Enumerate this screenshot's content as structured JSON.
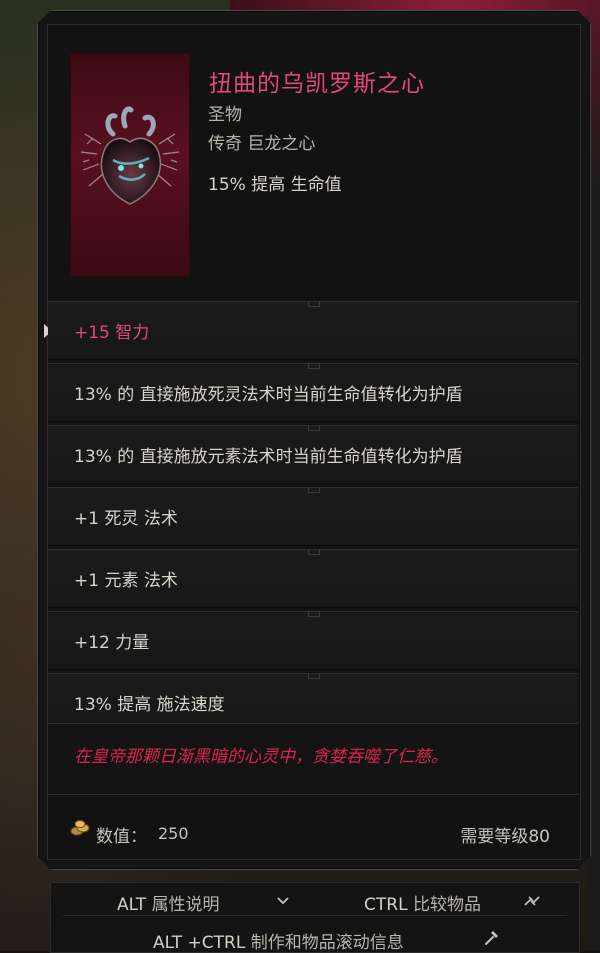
{
  "item": {
    "name": "扭曲的乌凯罗斯之心",
    "type": "圣物",
    "rarity": "传奇 巨龙之心",
    "implicit": "15% 提高 生命值",
    "art_icon": "twisted-heart-icon"
  },
  "mods": [
    {
      "text": "+15 智力",
      "highlight": true
    },
    {
      "text": "13% 的 直接施放死灵法术时当前生命值转化为护盾",
      "highlight": false
    },
    {
      "text": "13% 的 直接施放元素法术时当前生命值转化为护盾",
      "highlight": false
    },
    {
      "text": "+1 死灵 法术",
      "highlight": false
    },
    {
      "text": "+1 元素 法术",
      "highlight": false
    },
    {
      "text": "+12 力量",
      "highlight": false
    },
    {
      "text": "13% 提高 施法速度",
      "highlight": false
    }
  ],
  "flavor": "在皇帝那颗日渐黑暗的心灵中，贪婪吞噬了仁慈。",
  "footer": {
    "value_label": "数值：",
    "value": "250",
    "level_requirement": "需要等级80"
  },
  "hotkeys": {
    "alt_key": "ALT",
    "alt_label": "属性说明",
    "ctrl_key": "CTRL",
    "ctrl_label": "比较物品",
    "altctrl_key": "ALT +CTRL",
    "altctrl_label": "制作和物品滚动信息"
  },
  "colors": {
    "legendary": "#e04a78",
    "flavor": "#d8254e",
    "text": "#d8d4cc"
  }
}
